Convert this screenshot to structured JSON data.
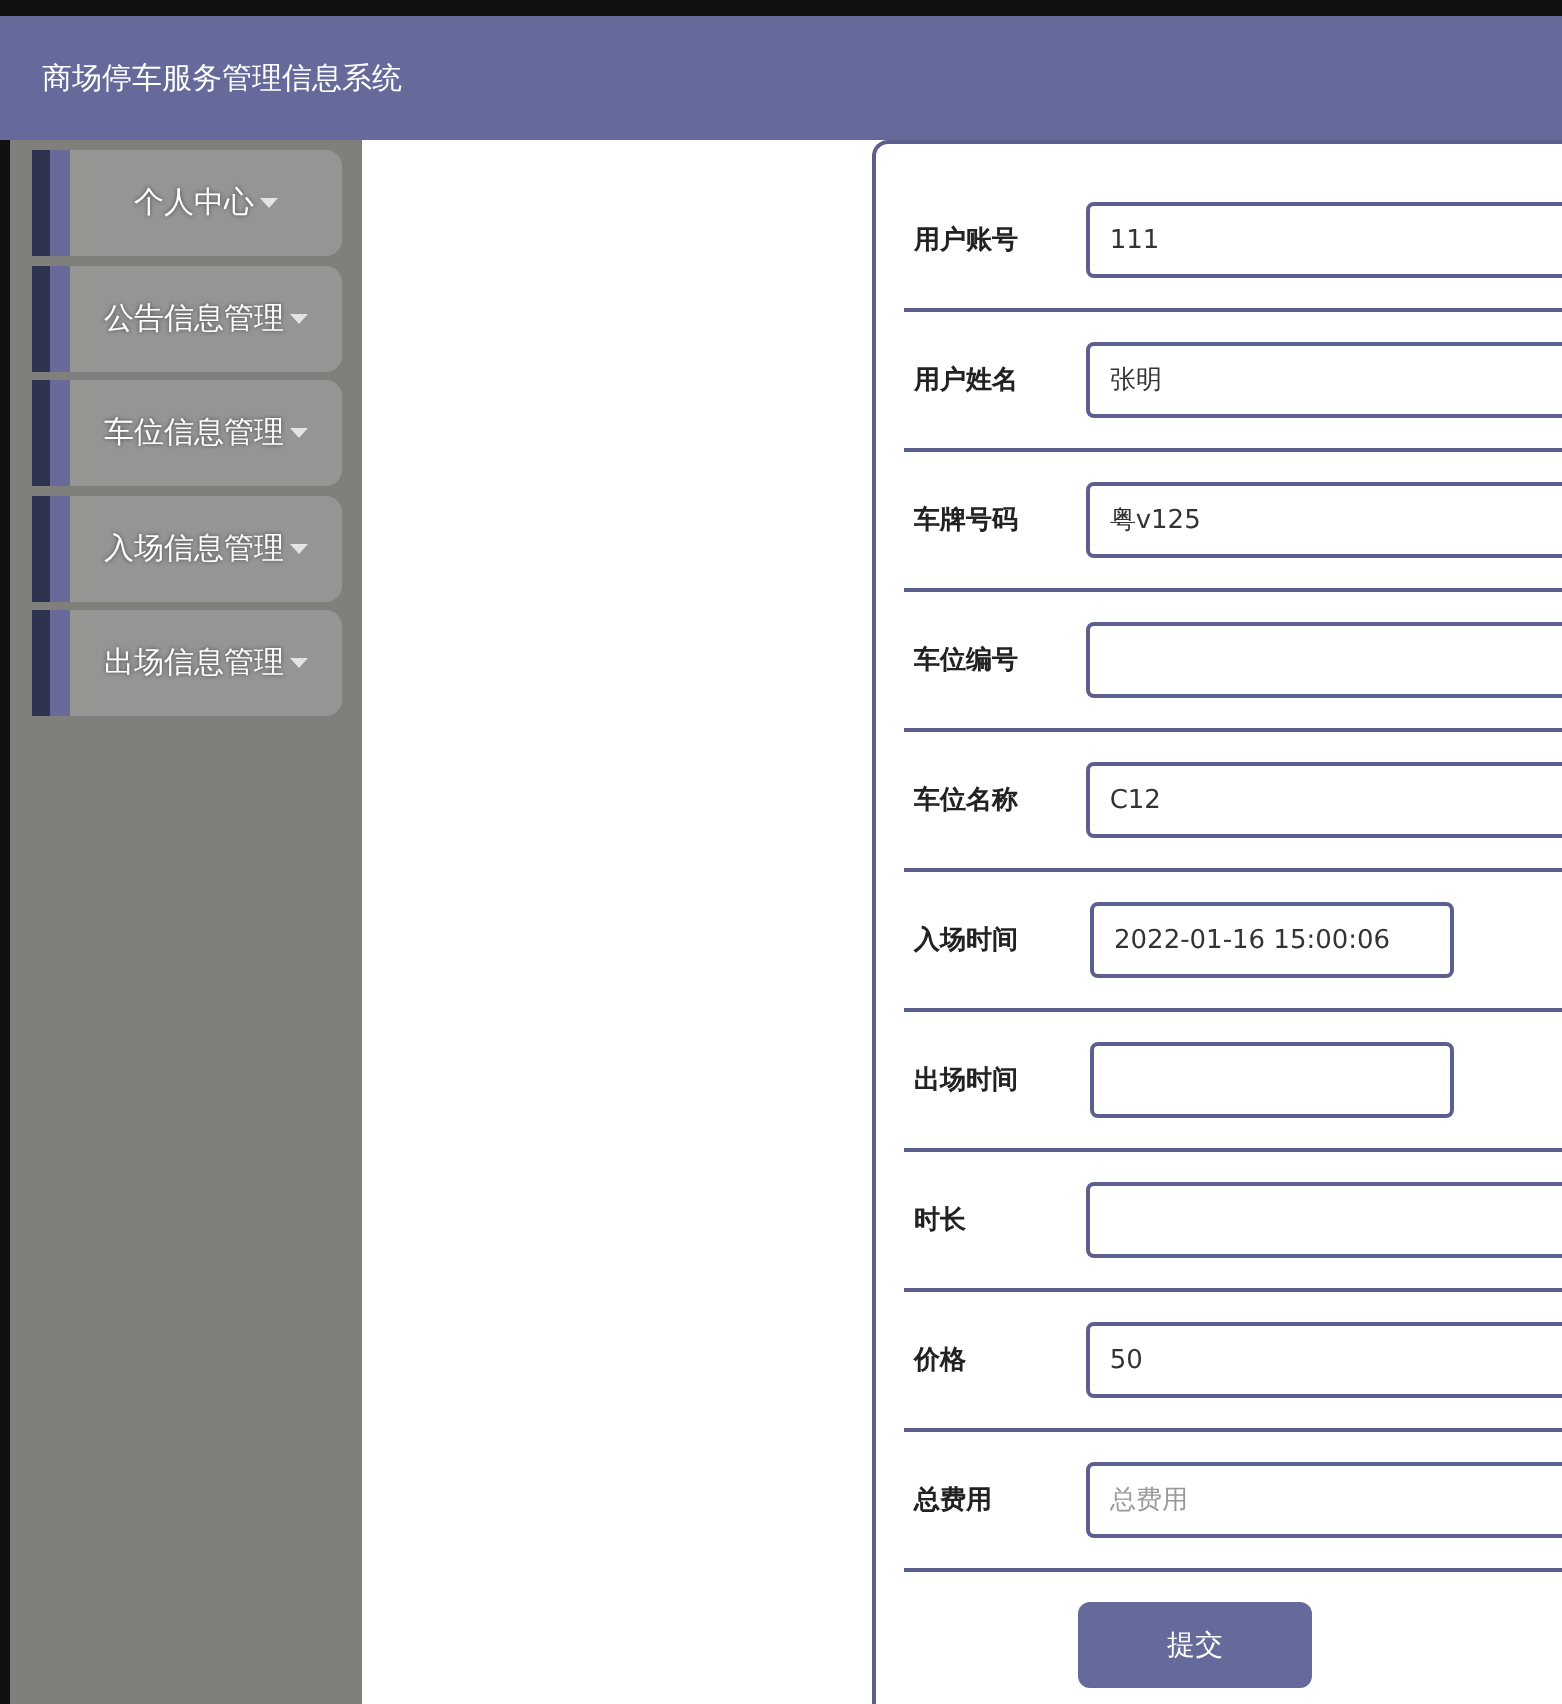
{
  "header": {
    "title": "商场停车服务管理信息系统"
  },
  "sidebar": {
    "items": [
      {
        "label": "个人中心"
      },
      {
        "label": "公告信息管理"
      },
      {
        "label": "车位信息管理"
      },
      {
        "label": "入场信息管理"
      },
      {
        "label": "出场信息管理"
      }
    ]
  },
  "form": {
    "fields": [
      {
        "label": "用户账号",
        "kind": "text",
        "value": "111"
      },
      {
        "label": "用户姓名",
        "kind": "text",
        "value": "张明"
      },
      {
        "label": "车牌号码",
        "kind": "text",
        "value": "粤v125"
      },
      {
        "label": "车位编号",
        "kind": "text"
      },
      {
        "label": "车位名称",
        "kind": "text",
        "value": "C12"
      },
      {
        "label": "入场时间",
        "kind": "date",
        "value": "2022-01-16 15:00:06"
      },
      {
        "label": "出场时间",
        "kind": "date"
      },
      {
        "label": "时长",
        "kind": "text"
      },
      {
        "label": "价格",
        "kind": "text",
        "value": "50"
      },
      {
        "label": "总费用",
        "kind": "text",
        "placeholder": "总费用"
      }
    ],
    "submit": "提交"
  }
}
